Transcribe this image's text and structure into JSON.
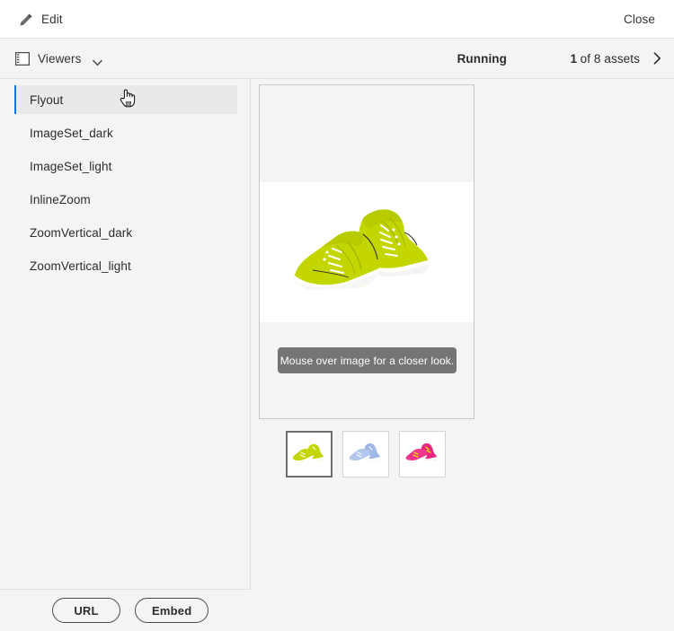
{
  "topbar": {
    "edit_label": "Edit",
    "edit_icon": "pencil-icon",
    "close_label": "Close"
  },
  "subbar": {
    "viewers_label": "Viewers",
    "viewers_icon": "panel-layout-icon",
    "dropdown_icon": "chevron-down-icon",
    "status": "Running",
    "asset_counter": {
      "current": "1",
      "suffix": "of 8 assets"
    },
    "next_icon": "chevron-right-icon"
  },
  "sidebar": {
    "items": [
      {
        "label": "Flyout",
        "selected": true
      },
      {
        "label": "ImageSet_dark",
        "selected": false
      },
      {
        "label": "ImageSet_light",
        "selected": false
      },
      {
        "label": "InlineZoom",
        "selected": false
      },
      {
        "label": "ZoomVertical_dark",
        "selected": false
      },
      {
        "label": "ZoomVertical_light",
        "selected": false
      }
    ],
    "footer": {
      "url_label": "URL",
      "embed_label": "Embed"
    }
  },
  "viewer": {
    "tooltip_text": "Mouse over image for a closer look.",
    "main_image_alt": "green-running-shoes",
    "thumbnails": [
      {
        "name": "thumbnail-green-shoes",
        "selected": true
      },
      {
        "name": "thumbnail-blue-shoes",
        "selected": false
      },
      {
        "name": "thumbnail-pink-shoes",
        "selected": false
      }
    ]
  },
  "cursor": {
    "icon": "pointing-hand-cursor"
  },
  "colors": {
    "accent_blue": "#1473e6",
    "tooltip_gray": "#757575",
    "page_background": "#f4f4f4",
    "shoe_green": "#c4d600",
    "shoe_blue": "#9fb8e8",
    "shoe_pink": "#e8257f"
  }
}
